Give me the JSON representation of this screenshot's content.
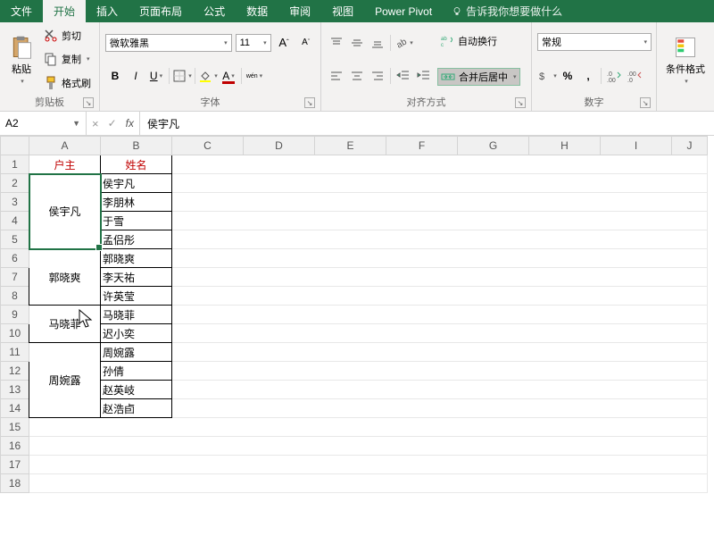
{
  "tabs": {
    "file": "文件",
    "home": "开始",
    "insert": "插入",
    "layout": "页面布局",
    "formulas": "公式",
    "data": "数据",
    "review": "审阅",
    "view": "视图",
    "powerpivot": "Power Pivot"
  },
  "tellme": "告诉我你想要做什么",
  "ribbon": {
    "clipboard": {
      "label": "剪贴板",
      "paste": "粘贴",
      "cut": "剪切",
      "copy": "复制",
      "painter": "格式刷"
    },
    "font": {
      "label": "字体",
      "name": "微软雅黑",
      "size": "11"
    },
    "alignment": {
      "label": "对齐方式",
      "wrap": "自动换行",
      "merge": "合并后居中"
    },
    "number": {
      "label": "数字",
      "format": "常规"
    },
    "styles": {
      "condfmt": "条件格式"
    }
  },
  "namebox": "A2",
  "formula": "侯宇凡",
  "columns": [
    "A",
    "B",
    "C",
    "D",
    "E",
    "F",
    "G",
    "H",
    "I",
    "J"
  ],
  "rows": [
    1,
    2,
    3,
    4,
    5,
    6,
    7,
    8,
    9,
    10,
    11,
    12,
    13,
    14,
    15,
    16,
    17,
    18
  ],
  "cells": {
    "a1": "户主",
    "b1": "姓名",
    "a2": "侯宇凡",
    "b2": "侯宇凡",
    "b3": "李朋林",
    "b4": "于雪",
    "b5": "孟侣彤",
    "a6": "郭晓爽",
    "b6": "郭晓爽",
    "b7": "李天祐",
    "b8": "许英莹",
    "a9": "马晓菲",
    "b9": "马晓菲",
    "b10": "迟小奕",
    "a11": "周婉露",
    "b11": "周婉露",
    "b12": "孙倩",
    "b13": "赵英岐",
    "b14": "赵浩卣"
  }
}
